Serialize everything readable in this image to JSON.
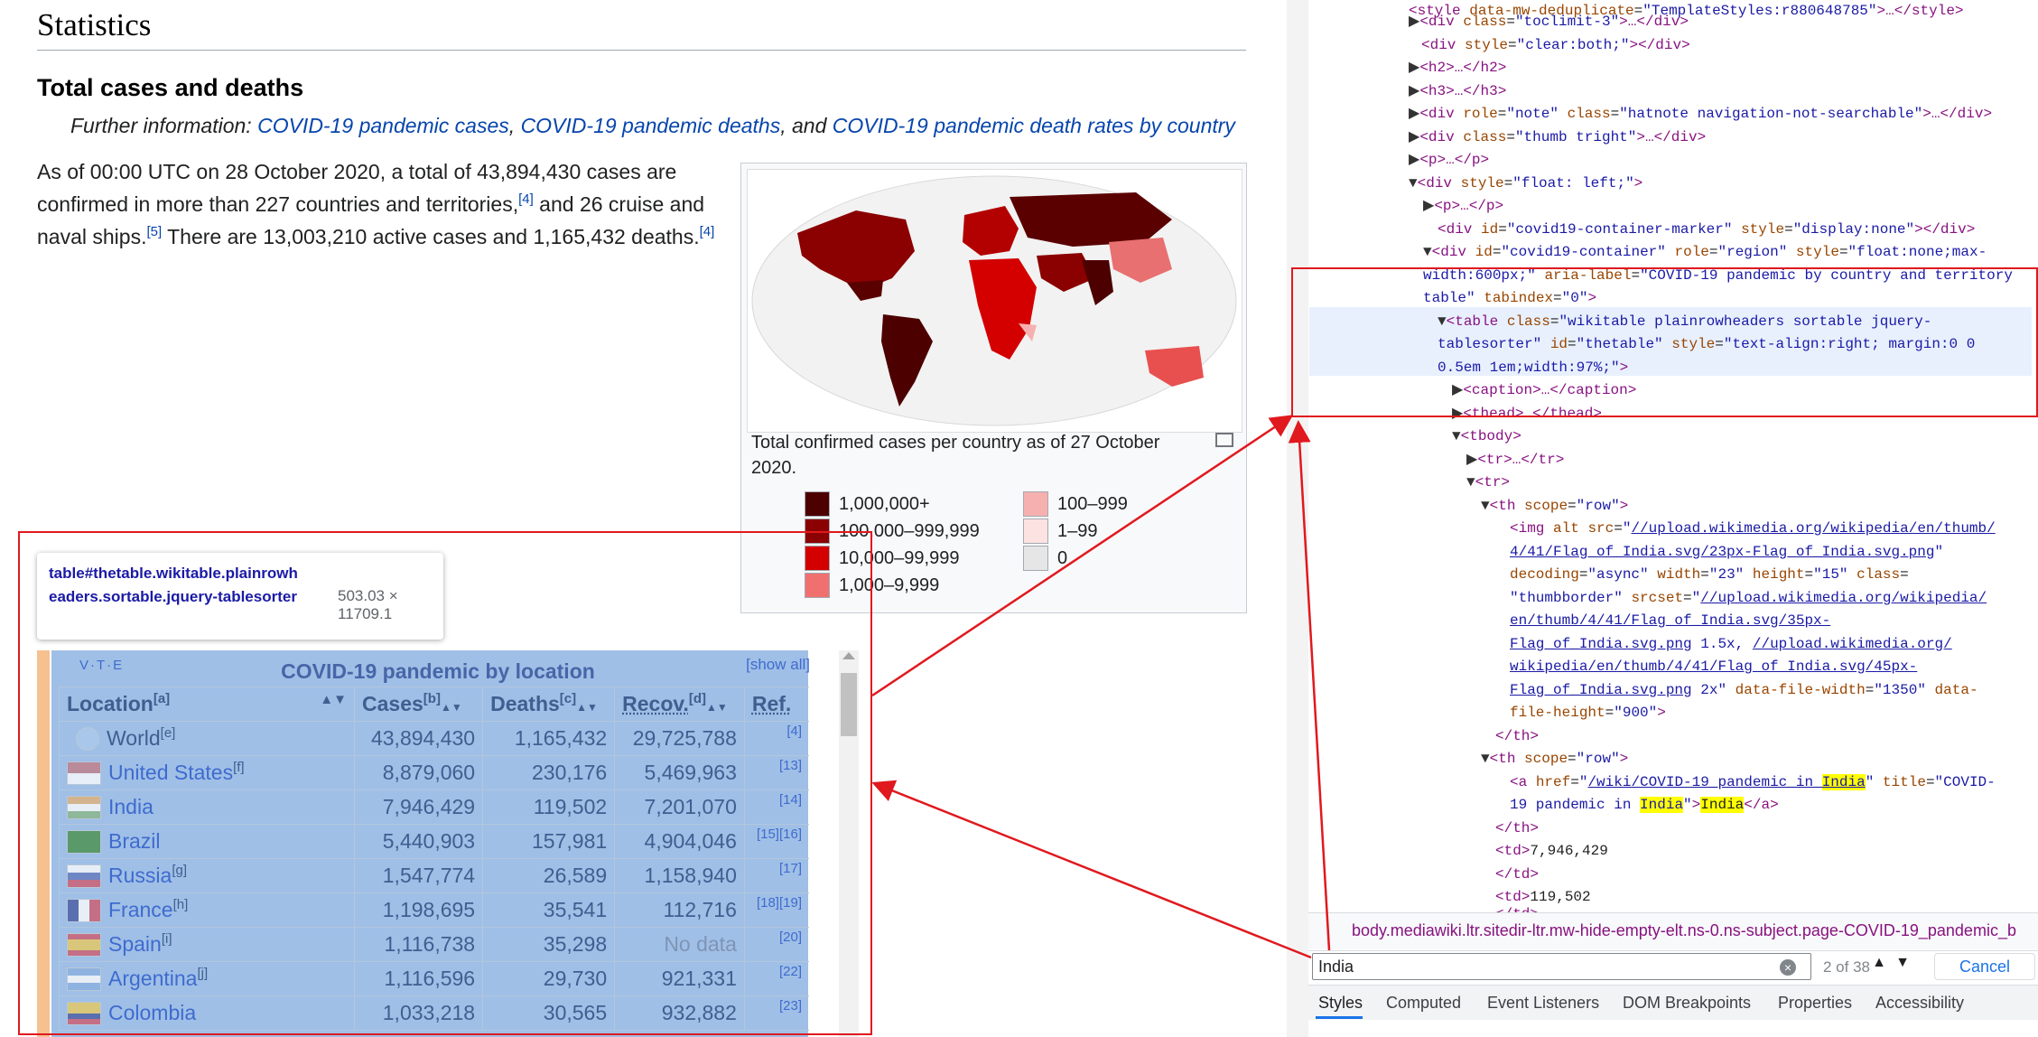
{
  "article": {
    "section_title": "Statistics",
    "subsection_title": "Total cases and deaths",
    "further_prefix": "Further information: ",
    "further_link1": "COVID-19 pandemic cases",
    "further_sep": ", ",
    "further_link2": "COVID-19 pandemic deaths",
    "further_and": ", and ",
    "further_link3": "COVID-19 pandemic death rates by country",
    "para_1": "As of 00:00 UTC on 28 October 2020, a total of 43,894,430 cases are confirmed in more than 227 countries and territories,",
    "ref_4": "[4]",
    "para_2": " and 26 cruise and naval ships.",
    "ref_5": "[5]",
    "para_3": " There are 13,003,210 active cases and 1,165,432 deaths.",
    "ref_4b": "[4]"
  },
  "map": {
    "caption": "Total confirmed cases per country as of 27 October 2020.",
    "legend": [
      {
        "label": "1,000,000+",
        "color": "#4d0000"
      },
      {
        "label": "100,000–999,999",
        "color": "#8b0000"
      },
      {
        "label": "10,000–99,999",
        "color": "#d40000"
      },
      {
        "label": "1,000–9,999",
        "color": "#f07070"
      },
      {
        "label": "100–999",
        "color": "#f7b0b0"
      },
      {
        "label": "1–99",
        "color": "#fde2e2"
      },
      {
        "label": "0",
        "color": "#e6e6e6"
      }
    ]
  },
  "tooltip": {
    "tag": "table",
    "selector": "#thetable.wikitable.plainrowheaders.sortable.jquery-tablesorter",
    "size": "503.03 × 11709.1"
  },
  "table": {
    "vte": "V·T·E",
    "caption": "COVID-19 pandemic by location",
    "show_all": "[show all]",
    "headers": {
      "location": "Location",
      "location_note": "[a]",
      "cases": "Cases",
      "cases_note": "[b]",
      "deaths": "Deaths",
      "deaths_note": "[c]",
      "recov": "Recov.",
      "recov_note": "[d]",
      "ref": "Ref."
    },
    "rows": [
      {
        "loc": "World",
        "note": "[e]",
        "cases": "43,894,430",
        "deaths": "1,165,432",
        "recov": "29,725,788",
        "ref": "[4]"
      },
      {
        "loc": "United States",
        "note": "[f]",
        "cases": "8,879,060",
        "deaths": "230,176",
        "recov": "5,469,963",
        "ref": "[13]"
      },
      {
        "loc": "India",
        "note": "",
        "cases": "7,946,429",
        "deaths": "119,502",
        "recov": "7,201,070",
        "ref": "[14]"
      },
      {
        "loc": "Brazil",
        "note": "",
        "cases": "5,440,903",
        "deaths": "157,981",
        "recov": "4,904,046",
        "ref": "[15][16]"
      },
      {
        "loc": "Russia",
        "note": "[g]",
        "cases": "1,547,774",
        "deaths": "26,589",
        "recov": "1,158,940",
        "ref": "[17]"
      },
      {
        "loc": "France",
        "note": "[h]",
        "cases": "1,198,695",
        "deaths": "35,541",
        "recov": "112,716",
        "ref": "[18][19]"
      },
      {
        "loc": "Spain",
        "note": "[i]",
        "cases": "1,116,738",
        "deaths": "35,298",
        "recov": "No data",
        "ref": "[20]"
      },
      {
        "loc": "Argentina",
        "note": "[j]",
        "cases": "1,116,596",
        "deaths": "29,730",
        "recov": "921,331",
        "ref": "[22]"
      },
      {
        "loc": "Colombia",
        "note": "",
        "cases": "1,033,218",
        "deaths": "30,565",
        "recov": "932,882",
        "ref": "[23]"
      }
    ]
  },
  "devtools": {
    "breadcrumb": "body.mediawiki.ltr.sitedir-ltr.mw-hide-empty-elt.ns-0.ns-subject.page-COVID-19_pandemic_b",
    "search_value": "India",
    "search_count": "2 of 38",
    "cancel": "Cancel",
    "tabs": [
      "Styles",
      "Computed",
      "Event Listeners",
      "DOM Breakpoints",
      "Properties",
      "Accessibility"
    ]
  },
  "colors": {
    "highlight_red": "#e0191e",
    "link": "#0645ad",
    "devtools_tag": "#881280"
  }
}
